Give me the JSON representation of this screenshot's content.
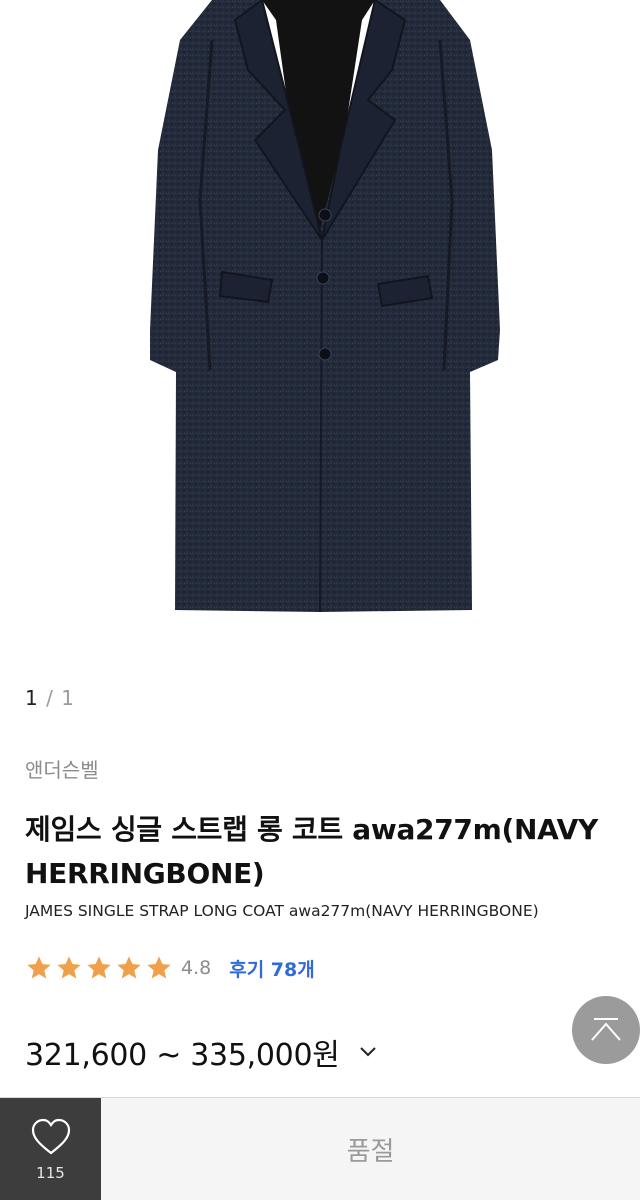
{
  "gallery": {
    "current": "1",
    "separator": "/",
    "total": "1"
  },
  "product": {
    "brand": "앤더슨벨",
    "title_ko": "제임스 싱글 스트랩 롱 코트 awa277m(NAVY HERRINGBONE)",
    "title_en": "JAMES SINGLE STRAP LONG COAT awa277m(NAVY HERRINGBONE)",
    "rating": {
      "stars": 5,
      "star_color": "#f0a04b",
      "value": "4.8",
      "reviews_label": "후기 78개"
    },
    "price_range": "321,600 ~ 335,000원"
  },
  "bottom_bar": {
    "wish_count": "115",
    "action_label": "품절"
  },
  "icons": {
    "price_toggle": "chevron-down-icon",
    "scroll_top": "arrow-up-icon",
    "wish": "heart-icon"
  }
}
